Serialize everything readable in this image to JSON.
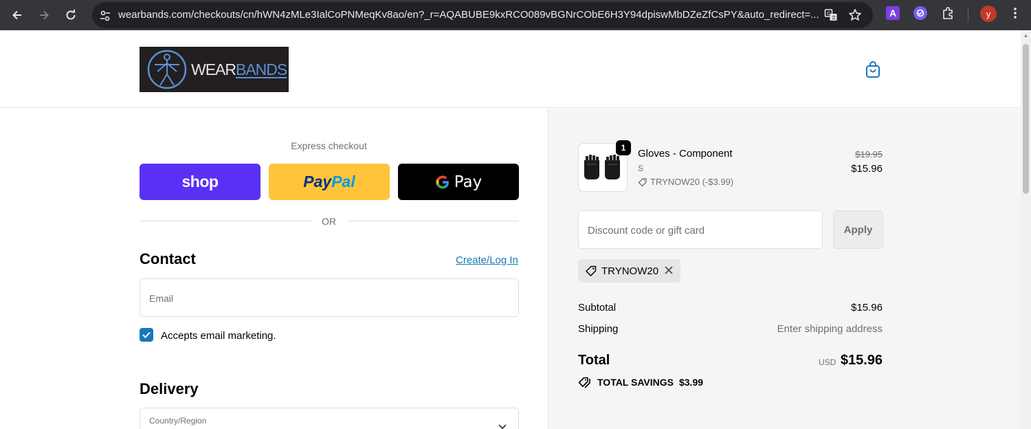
{
  "browser": {
    "url": "wearbands.com/checkouts/cn/hWN4zMLe3IalCoPNMeqKv8ao/en?_r=AQABUBE9kxRCO089vBGNrCObE6H3Y94dpiswMbDZeZfCsPY&auto_redirect=...",
    "profile_initial": "y",
    "ext_letter": "A"
  },
  "header": {
    "logo_wear": "WEAR",
    "logo_bands": "BANDS"
  },
  "express": {
    "label": "Express checkout",
    "shop_label": "shop",
    "paypal_pay": "Pay",
    "paypal_pal": "Pal",
    "gpay_label": "Pay",
    "or_label": "OR"
  },
  "contact": {
    "title": "Contact",
    "login_link": "Create/Log In",
    "email_placeholder": "Email",
    "marketing_label": "Accepts email marketing."
  },
  "delivery": {
    "title": "Delivery",
    "country_label": "Country/Region"
  },
  "summary": {
    "item": {
      "quantity": "1",
      "name": "Gloves - Component",
      "variant": "S",
      "discount": "TRYNOW20 (-$3.99)",
      "original_price": "$19.95",
      "price": "$15.96"
    },
    "discount_placeholder": "Discount code or gift card",
    "apply_label": "Apply",
    "applied_code": "TRYNOW20",
    "subtotal_label": "Subtotal",
    "subtotal_value": "$15.96",
    "shipping_label": "Shipping",
    "shipping_value": "Enter shipping address",
    "total_label": "Total",
    "currency": "USD",
    "total_value": "$15.96",
    "savings_label": "TOTAL SAVINGS",
    "savings_value": "$3.99"
  },
  "colors": {
    "shop": "#5a31f4",
    "paypal": "#ffc439",
    "link": "#1878b9"
  }
}
